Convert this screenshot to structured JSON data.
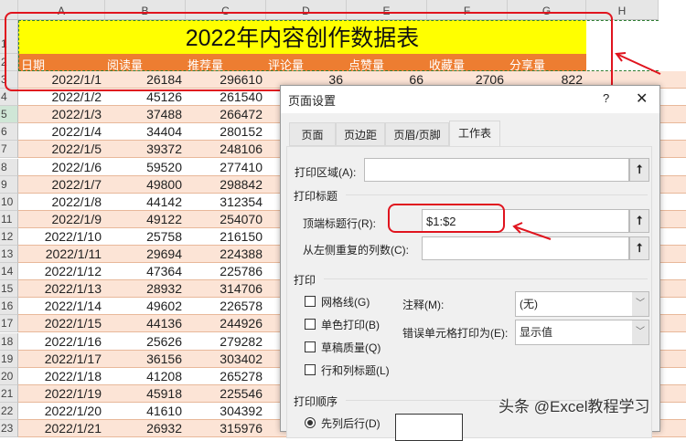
{
  "columns": [
    "A",
    "B",
    "C",
    "D",
    "E",
    "F",
    "G",
    "H"
  ],
  "sheet_title": "2022年内容创作数据表",
  "headers": [
    "日期",
    "阅读量",
    "推荐量",
    "评论量",
    "点赞量",
    "收藏量",
    "分享量"
  ],
  "row_numbers": [
    "1",
    "2",
    "3",
    "4",
    "5",
    "6",
    "7",
    "8",
    "9",
    "10",
    "11",
    "12",
    "13",
    "14",
    "15",
    "16",
    "17",
    "18",
    "19",
    "20",
    "21",
    "22",
    "23"
  ],
  "rows": [
    [
      "2022/1/1",
      "26184",
      "296610",
      "36",
      "66",
      "2706",
      "822"
    ],
    [
      "2022/1/2",
      "45126",
      "261540"
    ],
    [
      "2022/1/3",
      "37488",
      "266472"
    ],
    [
      "2022/1/4",
      "34404",
      "280152"
    ],
    [
      "2022/1/5",
      "39372",
      "248106"
    ],
    [
      "2022/1/6",
      "59520",
      "277410"
    ],
    [
      "2022/1/7",
      "49800",
      "298842"
    ],
    [
      "2022/1/8",
      "44142",
      "312354"
    ],
    [
      "2022/1/9",
      "49122",
      "254070"
    ],
    [
      "2022/1/10",
      "25758",
      "216150"
    ],
    [
      "2022/1/11",
      "29694",
      "224388"
    ],
    [
      "2022/1/12",
      "47364",
      "225786"
    ],
    [
      "2022/1/13",
      "28932",
      "314706"
    ],
    [
      "2022/1/14",
      "49602",
      "226578"
    ],
    [
      "2022/1/15",
      "44136",
      "244926"
    ],
    [
      "2022/1/16",
      "25626",
      "279282"
    ],
    [
      "2022/1/17",
      "36156",
      "303402"
    ],
    [
      "2022/1/18",
      "41208",
      "265278"
    ],
    [
      "2022/1/19",
      "45918",
      "225546"
    ],
    [
      "2022/1/20",
      "41610",
      "304392"
    ],
    [
      "2022/1/21",
      "26932",
      "315976"
    ]
  ],
  "dialog": {
    "title": "页面设置",
    "help": "?",
    "close": "✕",
    "tabs": [
      "页面",
      "页边距",
      "页眉/页脚",
      "工作表"
    ],
    "print_area_label": "打印区域(A):",
    "print_area_value": "",
    "print_titles_section": "打印标题",
    "rows_repeat_label": "顶端标题行(R):",
    "rows_repeat_value": "$1:$2",
    "cols_repeat_label": "从左侧重复的列数(C):",
    "cols_repeat_value": "",
    "print_section": "打印",
    "checkboxes": [
      "网格线(G)",
      "单色打印(B)",
      "草稿质量(Q)",
      "行和列标题(L)"
    ],
    "comments_label": "注释(M):",
    "comments_value": "(无)",
    "errors_label": "错误单元格打印为(E):",
    "errors_value": "显示值",
    "order_section": "打印顺序",
    "order_option": "先列后行(D)"
  },
  "watermark": "头条 @Excel教程学习",
  "colors": {
    "title_bg": "#ffff00",
    "header_bg": "#ed7d31",
    "band": "#fce4d6",
    "annotation": "#e0141e"
  }
}
